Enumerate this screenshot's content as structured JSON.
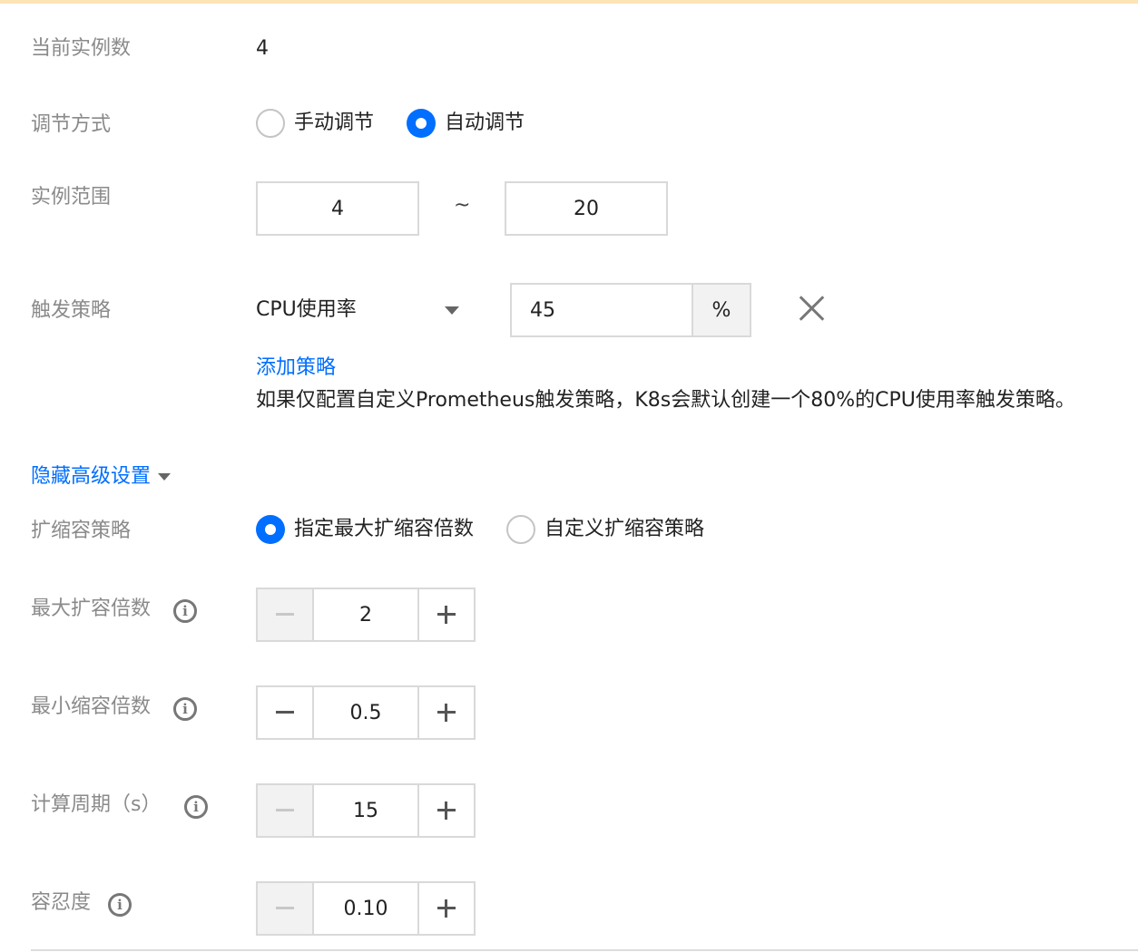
{
  "current_instances": {
    "label": "当前实例数",
    "value": "4"
  },
  "adjust_mode": {
    "label": "调节方式",
    "options": [
      {
        "label": "手动调节",
        "checked": false
      },
      {
        "label": "自动调节",
        "checked": true
      }
    ]
  },
  "instance_range": {
    "label": "实例范围",
    "min": "4",
    "separator": "~",
    "max": "20"
  },
  "trigger_policy": {
    "label": "触发策略",
    "metric": "CPU使用率",
    "value": "45",
    "unit": "%",
    "add_link": "添加策略",
    "hint": "如果仅配置自定义Prometheus触发策略，K8s会默认创建一个80%的CPU使用率触发策略。"
  },
  "advanced_toggle": "隐藏高级设置",
  "scaling_policy": {
    "label": "扩缩容策略",
    "options": [
      {
        "label": "指定最大扩缩容倍数",
        "checked": true
      },
      {
        "label": "自定义扩缩容策略",
        "checked": false
      }
    ]
  },
  "max_scale_up": {
    "label": "最大扩容倍数",
    "value": "2"
  },
  "min_scale_down": {
    "label": "最小缩容倍数",
    "value": "0.5"
  },
  "compute_period": {
    "label": "计算周期（s）",
    "value": "15"
  },
  "tolerance": {
    "label": "容忍度",
    "value": "0.10"
  },
  "colors": {
    "accent": "#006eff",
    "label": "#8a8a8a",
    "border": "#d9d9d9",
    "top_bar": "#fde4b4"
  }
}
